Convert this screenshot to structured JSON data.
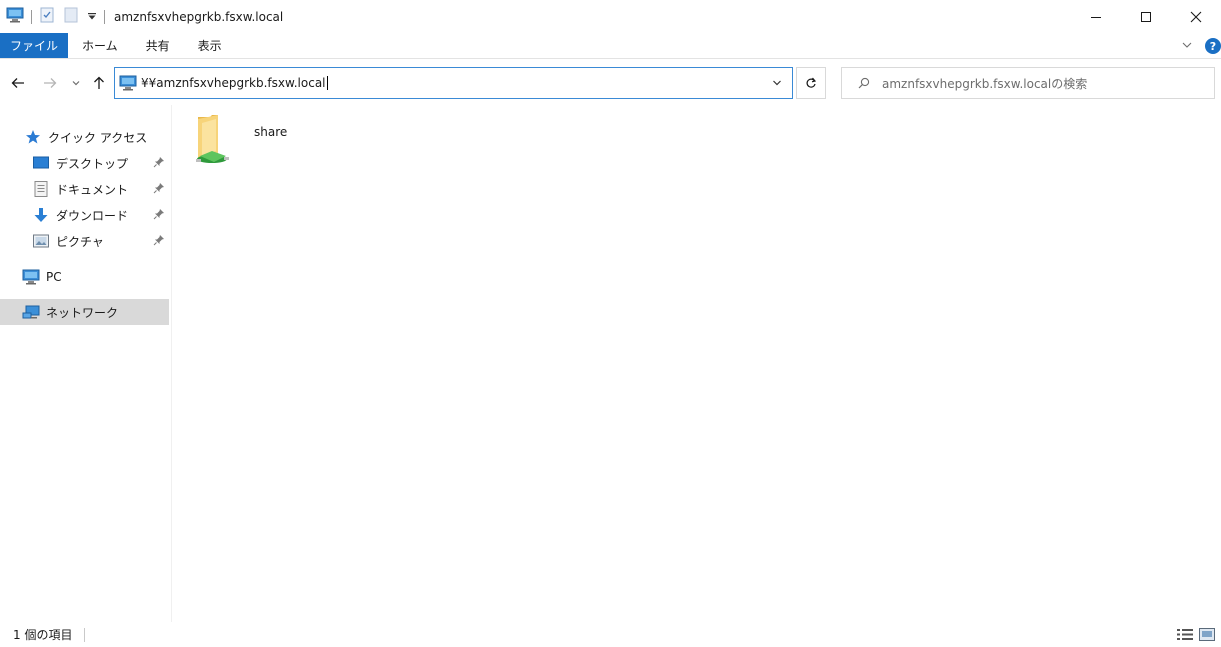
{
  "window": {
    "title": "amznfsxvhepgrkb.fsxw.local",
    "controls": [
      "minimize",
      "maximize",
      "close"
    ]
  },
  "quick_access_toolbar": {
    "icons": [
      "computer-icon",
      "properties-icon",
      "new-folder-icon",
      "customize-dropdown-icon"
    ]
  },
  "ribbon": {
    "tabs": [
      {
        "label": "ファイル",
        "active": true
      },
      {
        "label": "ホーム"
      },
      {
        "label": "共有"
      },
      {
        "label": "表示"
      }
    ],
    "help": "?"
  },
  "navigation": {
    "address": "¥¥amznfsxvhepgrkb.fsxw.local",
    "search_placeholder": "amznfsxvhepgrkb.fsxw.localの検索"
  },
  "sidebar": {
    "quick_access": {
      "label": "クイック アクセス",
      "items": [
        {
          "label": "デスクトップ",
          "pinned": true
        },
        {
          "label": "ドキュメント",
          "pinned": true
        },
        {
          "label": "ダウンロード",
          "pinned": true
        },
        {
          "label": "ピクチャ",
          "pinned": true
        }
      ]
    },
    "pc": {
      "label": "PC"
    },
    "network": {
      "label": "ネットワーク",
      "selected": true
    }
  },
  "content": {
    "items": [
      {
        "name": "share",
        "type": "shared-folder"
      }
    ]
  },
  "status": {
    "item_count": "1 個の項目"
  },
  "colors": {
    "accent": "#1a6fc4",
    "address_border": "#3a8ad6",
    "selected_bg": "#d9d9d9"
  }
}
